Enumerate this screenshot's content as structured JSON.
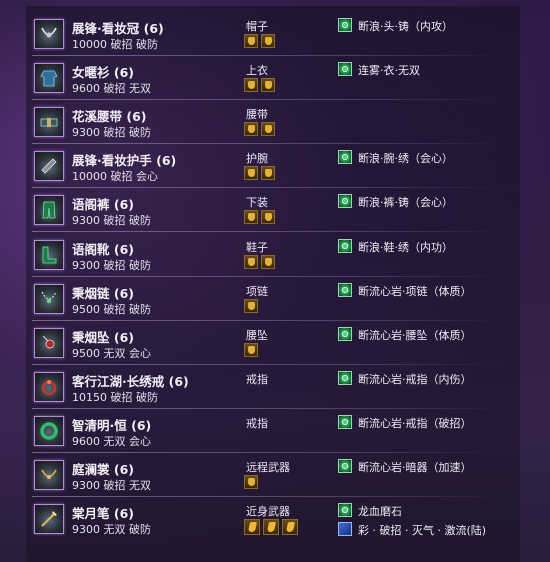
{
  "items": [
    {
      "icon": "necklace-crown-icon",
      "name": "展锋·看妆冠 (6)",
      "stats": "10000 破招 破防",
      "slot": "帽子",
      "sockets": 2,
      "enchant": "断浪·头·铸（内攻）"
    },
    {
      "icon": "armor-robe-icon",
      "name": "女暱衫 (6)",
      "stats": "9600 破招 无双",
      "slot": "上衣",
      "sockets": 2,
      "enchant": "连雾·衣·无双"
    },
    {
      "icon": "belt-icon",
      "name": "花溪腰带 (6)",
      "stats": "9300 破招 破防",
      "slot": "腰带",
      "sockets": 2,
      "enchant": ""
    },
    {
      "icon": "bracer-icon",
      "name": "展锋·看妆护手 (6)",
      "stats": "10000 破招 会心",
      "slot": "护腕",
      "sockets": 2,
      "enchant": "断浪·腕·绣（会心）"
    },
    {
      "icon": "pants-icon",
      "name": "语阁裤 (6)",
      "stats": "9300 破招 破防",
      "slot": "下装",
      "sockets": 2,
      "enchant": "断浪·裤·铸（会心）"
    },
    {
      "icon": "boots-icon",
      "name": "语阁靴 (6)",
      "stats": "9300 破招 破防",
      "slot": "鞋子",
      "sockets": 2,
      "enchant": "断浪·鞋·绣（内功）"
    },
    {
      "icon": "necklace-icon",
      "name": "秉烟链 (6)",
      "stats": "9500 破招 破防",
      "slot": "项链",
      "sockets": 1,
      "enchant": "断流心岩·项链（体质）"
    },
    {
      "icon": "pendant-icon",
      "name": "秉烟坠 (6)",
      "stats": "9500 无双 会心",
      "slot": "腰坠",
      "sockets": 1,
      "enchant": "断流心岩·腰坠（体质）"
    },
    {
      "icon": "ring-icon",
      "name": "客行江湖·长绣戒 (6)",
      "stats": "10150 破招 破防",
      "slot": "戒指",
      "sockets": 0,
      "enchant": "断流心岩·戒指（内伤）"
    },
    {
      "icon": "jade-ring-icon",
      "name": "智清明·恒 (6)",
      "stats": "9600 无双 会心",
      "slot": "戒指",
      "sockets": 0,
      "enchant": "断流心岩·戒指（破招）"
    },
    {
      "icon": "hidden-weapon-icon",
      "name": "庭澜裳 (6)",
      "stats": "9300 破招 无双",
      "slot": "远程武器",
      "sockets": 1,
      "enchant": "断流心岩·暗器（加速）"
    },
    {
      "icon": "brush-weapon-icon",
      "name": "棠月笔 (6)",
      "stats": "9300 无双 破防",
      "slot": "近身武器",
      "sockets": 3,
      "enchant": "龙血磨石",
      "enchant2": "彩 · 破招 · 灭气 · 激流(陆)"
    }
  ],
  "colors": {
    "accent": "#b58ad8",
    "text": "#f2eef6",
    "enchant_icon": "#3fbf6a",
    "socket": "#e2b23a"
  }
}
